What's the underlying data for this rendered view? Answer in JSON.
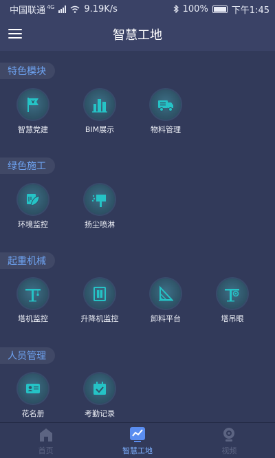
{
  "status": {
    "carrier": "中国联通",
    "network_tag": "4G",
    "speed": "9.19K/s",
    "battery": "100%",
    "time": "下午1:45"
  },
  "header": {
    "title": "智慧工地"
  },
  "sections": [
    {
      "title": "特色模块",
      "items": [
        {
          "label": "智慧党建",
          "icon": "flag-icon"
        },
        {
          "label": "BIM展示",
          "icon": "building-icon"
        },
        {
          "label": "物料管理",
          "icon": "truck-icon"
        }
      ]
    },
    {
      "title": "绿色施工",
      "items": [
        {
          "label": "环境监控",
          "icon": "leaf-icon"
        },
        {
          "label": "扬尘喷淋",
          "icon": "spray-icon"
        }
      ]
    },
    {
      "title": "起重机械",
      "items": [
        {
          "label": "塔机监控",
          "icon": "tower-crane-icon"
        },
        {
          "label": "升降机监控",
          "icon": "elevator-icon"
        },
        {
          "label": "卸料平台",
          "icon": "platform-icon"
        },
        {
          "label": "塔吊眼",
          "icon": "crane-eye-icon"
        }
      ]
    },
    {
      "title": "人员管理",
      "items": [
        {
          "label": "花名册",
          "icon": "id-card-icon"
        },
        {
          "label": "考勤记录",
          "icon": "calendar-check-icon"
        }
      ]
    }
  ],
  "tabs": [
    {
      "label": "首页",
      "active": false
    },
    {
      "label": "智慧工地",
      "active": true
    },
    {
      "label": "视频",
      "active": false
    }
  ],
  "colors": {
    "accent": "#6ea3f2",
    "icon_teal": "#25c3c6",
    "bg": "#323a5a"
  }
}
